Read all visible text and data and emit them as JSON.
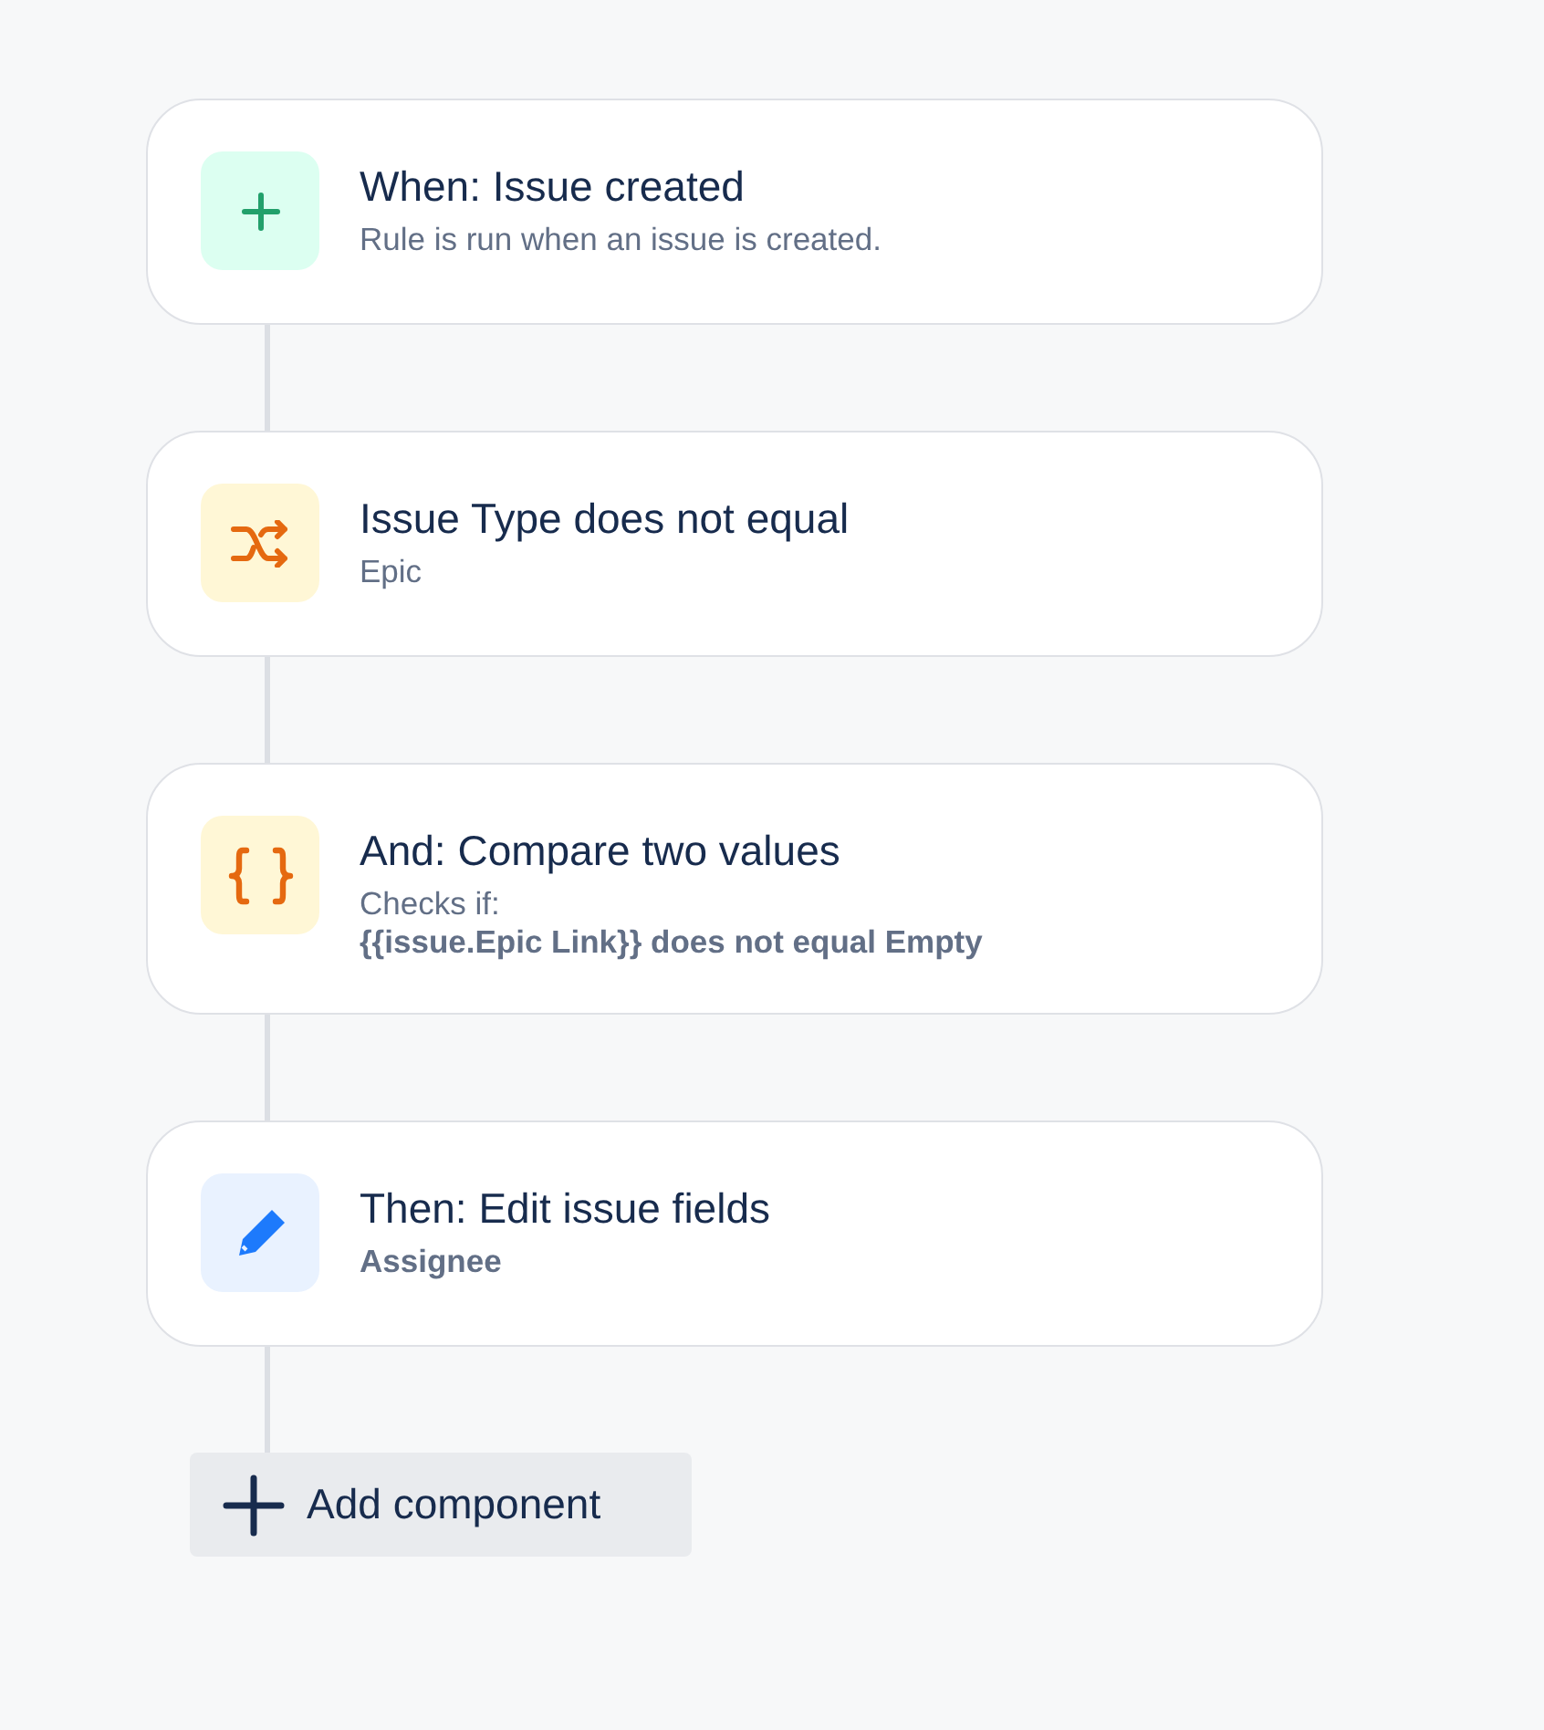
{
  "steps": [
    {
      "kind": "trigger",
      "title": "When: Issue created",
      "lines": [
        {
          "text": "Rule is run when an issue is created.",
          "bold": false
        }
      ]
    },
    {
      "kind": "condition",
      "title": "Issue Type does not equal",
      "lines": [
        {
          "text": "Epic",
          "bold": false
        }
      ]
    },
    {
      "kind": "compare",
      "title": "And: Compare two values",
      "lines": [
        {
          "text": "Checks if:",
          "bold": false
        },
        {
          "text": "{{issue.Epic Link}} does not equal Empty",
          "bold": true
        }
      ]
    },
    {
      "kind": "action",
      "title": "Then: Edit issue fields",
      "lines": [
        {
          "text": "Assignee",
          "bold": true
        }
      ]
    }
  ],
  "add_button": {
    "label": "Add component"
  }
}
